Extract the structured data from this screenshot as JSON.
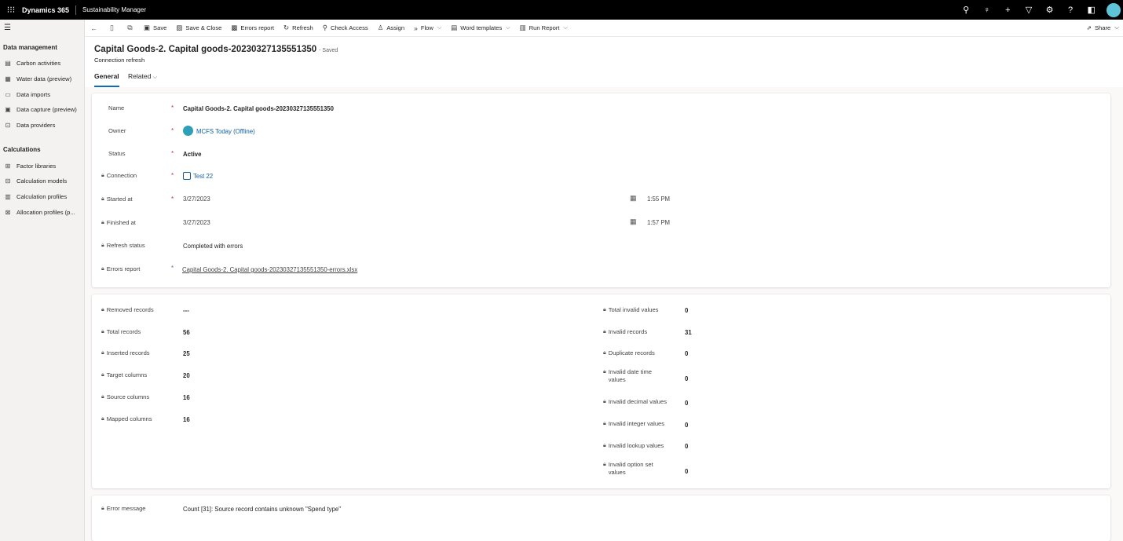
{
  "topbar": {
    "app_name": "Dynamics 365",
    "area_name": "Sustainability Manager",
    "icons": [
      "search-icon",
      "lightbulb-icon",
      "plus-icon",
      "filter-icon",
      "settings-icon",
      "help-icon",
      "copilot-icon",
      "avatar"
    ]
  },
  "sidebar": {
    "group1_title": "Data management",
    "group1_items": [
      {
        "label": "Carbon activities",
        "icon": "carbon-icon"
      },
      {
        "label": "Water data (preview)",
        "icon": "water-icon"
      },
      {
        "label": "Data imports",
        "icon": "import-icon"
      },
      {
        "label": "Data capture (preview)",
        "icon": "capture-icon"
      },
      {
        "label": "Data providers",
        "icon": "provider-icon"
      }
    ],
    "group2_title": "Calculations",
    "group2_items": [
      {
        "label": "Factor libraries",
        "icon": "library-icon"
      },
      {
        "label": "Calculation models",
        "icon": "model-icon"
      },
      {
        "label": "Calculation profiles",
        "icon": "profile-icon"
      },
      {
        "label": "Allocation profiles (p...",
        "icon": "allocation-icon"
      }
    ]
  },
  "commandbar": {
    "save": "Save",
    "save_close": "Save & Close",
    "errors_report": "Errors report",
    "refresh": "Refresh",
    "check_access": "Check Access",
    "assign": "Assign",
    "flow": "Flow",
    "word_templates": "Word templates",
    "run_report": "Run Report",
    "share": "Share"
  },
  "header": {
    "title": "Capital Goods-2. Capital goods-20230327135551350",
    "saved_status": "- Saved",
    "entity": "Connection refresh"
  },
  "tabs": {
    "general": "General",
    "related": "Related"
  },
  "general": {
    "name_label": "Name",
    "name_value": "Capital Goods-2. Capital goods-20230327135551350",
    "owner_label": "Owner",
    "owner_value": "MCFS Today (Offline)",
    "status_label": "Status",
    "status_value": "Active",
    "connection_label": "Connection",
    "connection_value": "Test 22",
    "started_label": "Started at",
    "started_date": "3/27/2023",
    "started_time": "1:55 PM",
    "finished_label": "Finished at",
    "finished_date": "3/27/2023",
    "finished_time": "1:57 PM",
    "refresh_status_label": "Refresh status",
    "refresh_status_value": "Completed with errors",
    "errors_report_label": "Errors report",
    "errors_report_value": "Capital Goods-2. Capital goods-20230327135551350-errors.xlsx"
  },
  "stats": {
    "removed_label": "Removed records",
    "removed_value": "---",
    "total_records_label": "Total records",
    "total_records_value": "56",
    "inserted_label": "Inserted records",
    "inserted_value": "25",
    "target_label": "Target columns",
    "target_value": "20",
    "source_label": "Source columns",
    "source_value": "16",
    "mapped_label": "Mapped columns",
    "mapped_value": "16",
    "total_invalid_label": "Total invalid values",
    "total_invalid_value": "0",
    "invalid_records_label": "Invalid records",
    "invalid_records_value": "31",
    "duplicate_label": "Duplicate records",
    "duplicate_value": "0",
    "invalid_datetime_label": "Invalid date time values",
    "invalid_datetime_value": "0",
    "invalid_decimal_label": "Invalid decimal values",
    "invalid_decimal_value": "0",
    "invalid_integer_label": "Invalid integer values",
    "invalid_integer_value": "0",
    "invalid_lookup_label": "Invalid lookup values",
    "invalid_lookup_value": "0",
    "invalid_optionset_label": "Invalid option set values",
    "invalid_optionset_value": "0"
  },
  "error": {
    "label": "Error message",
    "value": "Count [31]: Source record contains unknown \"Spend type\""
  },
  "colors": {
    "topbar": "#000000",
    "accent": "#0f6cbd",
    "link": "#115ea3",
    "required": "#c4314b"
  }
}
